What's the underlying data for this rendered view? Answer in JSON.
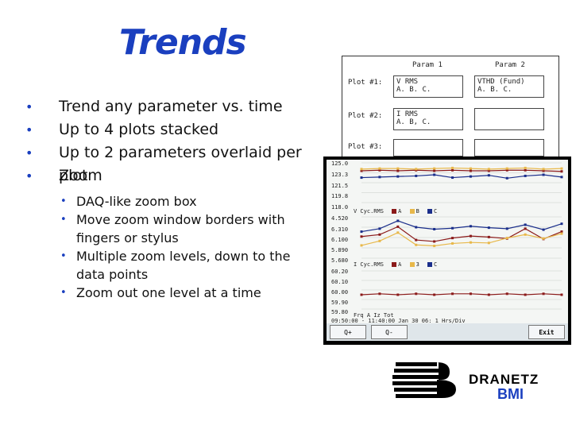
{
  "slide": {
    "title": "Trends",
    "bullets": [
      "Trend any parameter vs. time",
      "Up to 4 plots stacked",
      "Up to 2 parameters overlaid per plot",
      "Zoom"
    ],
    "sub_bullets": [
      "DAQ-like zoom box",
      "Move zoom window borders with fingers or stylus",
      "Multiple zoom levels, down to the data points",
      "Zoom out one level at a time"
    ],
    "bullet_glyph": "•"
  },
  "settings_panel": {
    "col1": "Param 1",
    "col2": "Param 2",
    "rows": [
      {
        "label": "Plot #1:",
        "p1_line1": "V RMS",
        "p1_line2": "A. B. C.",
        "p2_line1": "VTHD (Fund)",
        "p2_line2": "A. B. C."
      },
      {
        "label": "Plot #2:",
        "p1_line1": "I RMS",
        "p1_line2": "A. B, C.",
        "p2_line1": "",
        "p2_line2": ""
      },
      {
        "label": "Plot #3:",
        "p1_line1": "",
        "p1_line2": "",
        "p2_line1": "",
        "p2_line2": ""
      }
    ]
  },
  "trend_screen": {
    "y_labels_top": [
      "125.0",
      "123.3",
      "121.5",
      "119.8",
      "118.0"
    ],
    "y_labels_mid": [
      "4.520",
      "6.310",
      "6.100",
      "5.890",
      "5.680"
    ],
    "y_labels_bot": [
      "60.20",
      "60.10",
      "60.00",
      "59.90",
      "59.80"
    ],
    "legend1": {
      "name": "V Cyc.RMS",
      "a": "A",
      "b": "B",
      "c": "C"
    },
    "legend2": {
      "name": "I Cyc.RMS",
      "a": "A",
      "b": "3",
      "c": "C"
    },
    "status_line1": "Frq A Iz    Tot",
    "status_line2": "09:50:00 - 11:40:00  Jan 30 06:    1 Hrs/Div",
    "buttons": [
      "Q+",
      "Q-",
      "Exit"
    ],
    "colors": {
      "a": "#8b1a1a",
      "b": "#e8b84a",
      "c": "#1a2e8b"
    }
  },
  "chart_data": {
    "type": "line",
    "title": "",
    "panels": [
      {
        "ylim": [
          118.0,
          125.0
        ],
        "series": [
          {
            "name": "A",
            "values": [
              123.6,
              123.7,
              123.6,
              123.7,
              123.6,
              123.7,
              123.6,
              123.6,
              123.7,
              123.7,
              123.6,
              123.5
            ]
          },
          {
            "name": "B",
            "values": [
              123.9,
              124.0,
              124.0,
              123.9,
              124.0,
              124.1,
              124.0,
              123.9,
              124.0,
              124.1,
              123.9,
              124.0
            ]
          },
          {
            "name": "C",
            "values": [
              122.4,
              122.5,
              122.6,
              122.7,
              122.9,
              122.4,
              122.6,
              122.8,
              122.3,
              122.7,
              122.9,
              122.5
            ]
          }
        ]
      },
      {
        "ylim": [
          5.68,
          6.52
        ],
        "series": [
          {
            "name": "A",
            "values": [
              6.12,
              6.16,
              6.32,
              6.05,
              6.02,
              6.09,
              6.13,
              6.11,
              6.08,
              6.28,
              6.07,
              6.22
            ]
          },
          {
            "name": "B",
            "values": [
              5.94,
              6.03,
              6.2,
              5.95,
              5.93,
              5.98,
              6.0,
              5.99,
              6.09,
              6.16,
              6.08,
              6.18
            ]
          },
          {
            "name": "C",
            "values": [
              6.22,
              6.28,
              6.44,
              6.31,
              6.27,
              6.29,
              6.33,
              6.3,
              6.28,
              6.36,
              6.26,
              6.38
            ]
          }
        ]
      },
      {
        "ylim": [
          59.8,
          60.2
        ],
        "series": [
          {
            "name": "A",
            "values": [
              59.95,
              59.96,
              59.95,
              59.96,
              59.95,
              59.96,
              59.96,
              59.95,
              59.96,
              59.95,
              59.96,
              59.95
            ]
          }
        ]
      }
    ]
  }
}
